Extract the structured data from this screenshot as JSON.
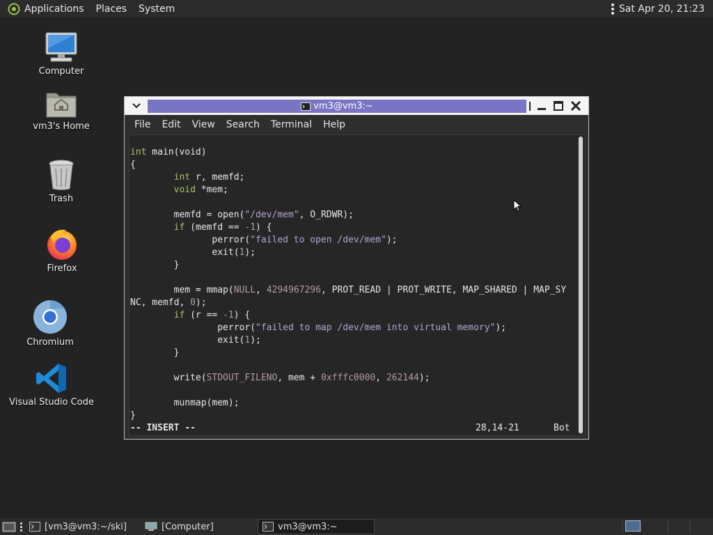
{
  "top_panel": {
    "menus": [
      "Applications",
      "Places",
      "System"
    ],
    "clock": "Sat Apr 20, 21:23"
  },
  "desktop": {
    "icons": [
      {
        "label": "Computer",
        "icon": "computer-icon"
      },
      {
        "label": "vm3's Home",
        "icon": "home-folder-icon"
      },
      {
        "label": "Trash",
        "icon": "trash-icon"
      },
      {
        "label": "Firefox",
        "icon": "firefox-icon"
      },
      {
        "label": "Chromium",
        "icon": "chromium-icon"
      },
      {
        "label": "Visual Studio Code",
        "icon": "vscode-icon"
      }
    ]
  },
  "terminal": {
    "title": "vm3@vm3:~",
    "menu": [
      "File",
      "Edit",
      "View",
      "Search",
      "Terminal",
      "Help"
    ],
    "status_mode": "-- INSERT --",
    "status_position": "28,14-21",
    "status_scroll": "Bot"
  },
  "code_lines": [
    [
      {
        "t": "int",
        "c": "kw"
      },
      {
        "t": " main(void)"
      }
    ],
    [
      {
        "t": "{"
      }
    ],
    [
      {
        "t": "        "
      },
      {
        "t": "int",
        "c": "kw"
      },
      {
        "t": " r, memfd;"
      }
    ],
    [
      {
        "t": "        "
      },
      {
        "t": "void",
        "c": "kw"
      },
      {
        "t": " *mem;"
      }
    ],
    [
      {
        "t": ""
      }
    ],
    [
      {
        "t": "        memfd = open("
      },
      {
        "t": "\"/dev/mem\"",
        "c": "str"
      },
      {
        "t": ", O_RDWR);"
      }
    ],
    [
      {
        "t": "        "
      },
      {
        "t": "if",
        "c": "kw"
      },
      {
        "t": " (memfd == "
      },
      {
        "t": "-1",
        "c": "num"
      },
      {
        "t": ") {"
      }
    ],
    [
      {
        "t": "               perror("
      },
      {
        "t": "\"failed to open /dev/mem\"",
        "c": "str"
      },
      {
        "t": ");"
      }
    ],
    [
      {
        "t": "               exit("
      },
      {
        "t": "1",
        "c": "num"
      },
      {
        "t": ");"
      }
    ],
    [
      {
        "t": "        }"
      }
    ],
    [
      {
        "t": ""
      }
    ],
    [
      {
        "t": "        mem = mmap("
      },
      {
        "t": "NULL",
        "c": "num"
      },
      {
        "t": ", "
      },
      {
        "t": "4294967296",
        "c": "num"
      },
      {
        "t": ", PROT_READ | PROT_WRITE, MAP_SHARED | MAP_SY"
      }
    ],
    [
      {
        "t": "NC, memfd, "
      },
      {
        "t": "0",
        "c": "num"
      },
      {
        "t": ");"
      }
    ],
    [
      {
        "t": "        "
      },
      {
        "t": "if",
        "c": "kw"
      },
      {
        "t": " (r == "
      },
      {
        "t": "-1",
        "c": "num"
      },
      {
        "t": ") {"
      }
    ],
    [
      {
        "t": "                perror("
      },
      {
        "t": "\"failed to map /dev/mem into virtual memory\"",
        "c": "str"
      },
      {
        "t": ");"
      }
    ],
    [
      {
        "t": "                exit("
      },
      {
        "t": "1",
        "c": "num"
      },
      {
        "t": ");"
      }
    ],
    [
      {
        "t": "        }"
      }
    ],
    [
      {
        "t": ""
      }
    ],
    [
      {
        "t": "        write("
      },
      {
        "t": "STDOUT_FILENO",
        "c": "num"
      },
      {
        "t": ", mem + "
      },
      {
        "t": "0xfffc0000",
        "c": "num"
      },
      {
        "t": ", "
      },
      {
        "t": "262144",
        "c": "num"
      },
      {
        "t": ");"
      }
    ],
    [
      {
        "t": ""
      }
    ],
    [
      {
        "t": "        munmap(mem);"
      }
    ],
    [
      {
        "t": "}"
      }
    ]
  ],
  "taskbar": {
    "tasks": [
      {
        "label": "[vm3@vm3:~/ski]",
        "icon": "terminal-icon"
      },
      {
        "label": "[Computer]",
        "icon": "computer-icon"
      },
      {
        "label": "vm3@vm3:~",
        "icon": "terminal-icon",
        "active": true
      }
    ]
  },
  "colors": {
    "desktop_bg": "#232323",
    "title_strip": "#7a74c4",
    "keyword": "#a8c46a",
    "string": "#b7a3d7",
    "number": "#b39aa8"
  }
}
